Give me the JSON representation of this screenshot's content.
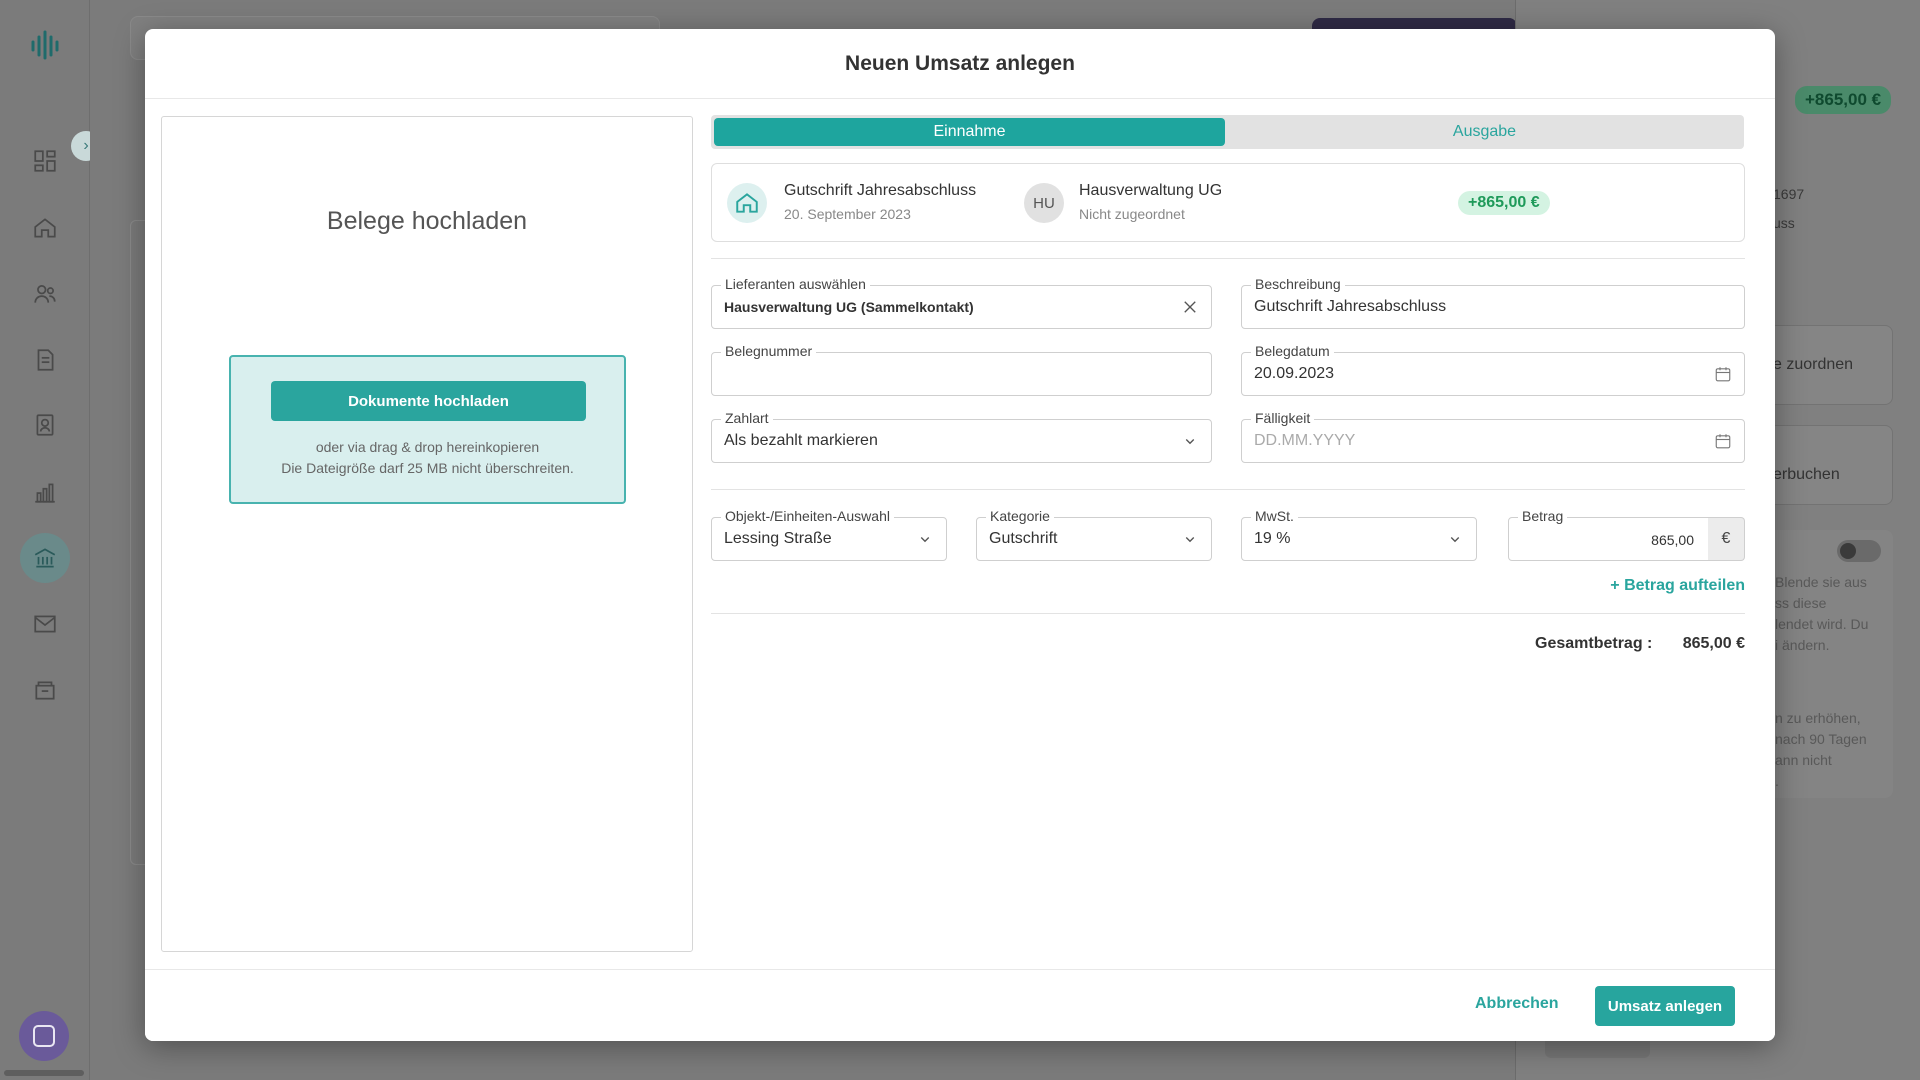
{
  "modal": {
    "title": "Neuen Umsatz anlegen",
    "upload": {
      "heading": "Belege hochladen",
      "button_label": "Dokumente hochladen",
      "hint_line1": "oder via drag & drop hereinkopieren",
      "hint_line2": "Die Dateigröße darf 25 MB nicht überschreiten."
    },
    "type_toggle": {
      "income_label": "Einnahme",
      "expense_label": "Ausgabe",
      "selected": "Einnahme"
    },
    "summary": {
      "title": "Gutschrift Jahresabschluss",
      "date": "20. September 2023",
      "avatar_initials": "HU",
      "contact_name": "Hausverwaltung UG",
      "contact_status": "Nicht zugeordnet",
      "amount_badge": "+865,00 €"
    },
    "form": {
      "supplier": {
        "label": "Lieferanten auswählen",
        "value": "Hausverwaltung UG (Sammelkontakt)",
        "clear_icon": "close-icon"
      },
      "description": {
        "label": "Beschreibung",
        "value": "Gutschrift Jahresabschluss"
      },
      "receipt_number": {
        "label": "Belegnummer",
        "value": ""
      },
      "receipt_date": {
        "label": "Belegdatum",
        "value": "20.09.2023"
      },
      "payment_method": {
        "label": "Zahlart",
        "value": "Als bezahlt markieren"
      },
      "due_date": {
        "label": "Fälligkeit",
        "placeholder": "DD.MM.YYYY"
      },
      "object_unit": {
        "label": "Objekt-/Einheiten-Auswahl",
        "value": "Lessing Straße"
      },
      "category": {
        "label": "Kategorie",
        "value": "Gutschrift"
      },
      "vat": {
        "label": "MwSt.",
        "value": "19 %"
      },
      "amount": {
        "label": "Betrag",
        "value": "865,00",
        "currency": "€"
      },
      "split_link": "+ Betrag aufteilen",
      "total_label": "Gesamtbetrag :",
      "total_value": "865,00 €"
    },
    "footer": {
      "cancel_label": "Abbrechen",
      "submit_label": "Umsatz anlegen"
    }
  },
  "background": {
    "panel_badge": "+865,00 €",
    "panel_text1": "1697",
    "panel_text2": "uss",
    "card1_label": "e zuordnen",
    "card2_label": "erbuchen",
    "info_lines": [
      "Blende sie aus",
      "ss diese",
      "lendet wird. Du",
      "i ändern.",
      "",
      "",
      "n zu erhöhen,",
      "nach 90 Tagen",
      "ann nicht",
      "."
    ]
  },
  "colors": {
    "accent": "#2aa59e",
    "badge_bg": "#d4f3e2",
    "badge_text": "#1f9a5a"
  }
}
